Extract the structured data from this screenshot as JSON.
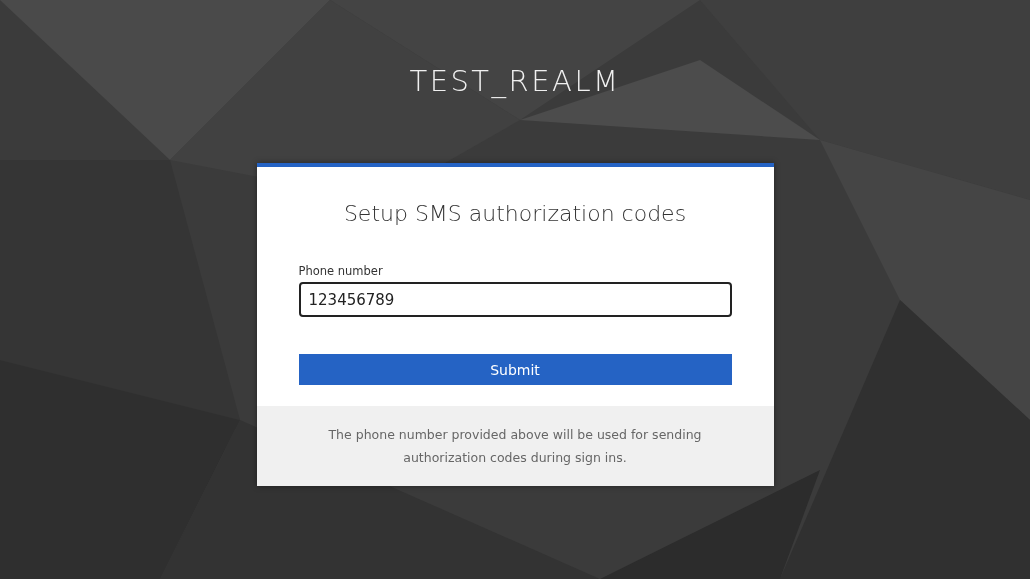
{
  "realm_title": "TEST_REALM",
  "card": {
    "heading": "Setup SMS authorization codes",
    "field": {
      "label": "Phone number",
      "value": "123456789"
    },
    "submit": "Submit",
    "info": "The phone number provided above will be used for sending authorization codes during sign ins."
  }
}
